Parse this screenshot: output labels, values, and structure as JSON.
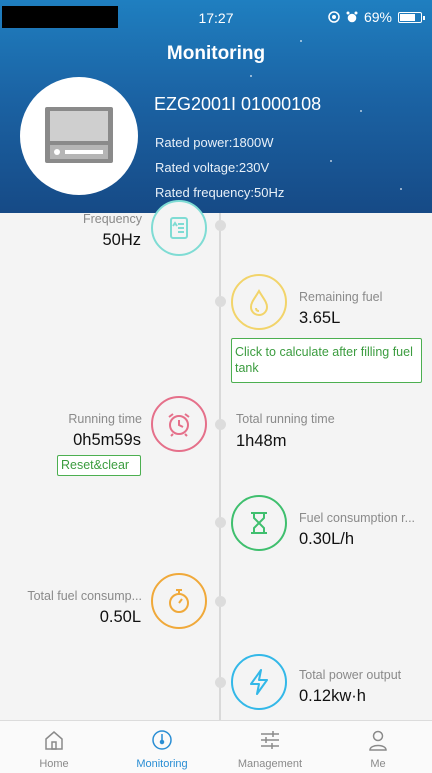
{
  "status_bar": {
    "time": "17:27",
    "battery": "69%"
  },
  "header": {
    "title": "Monitoring",
    "device_model": "EZG2001I 01000108",
    "rated_power": "Rated power:1800W",
    "rated_voltage": "Rated voltage:230V",
    "rated_frequency": "Rated frequency:50Hz"
  },
  "metrics": {
    "frequency": {
      "label": "Frequency",
      "value": "50Hz"
    },
    "remaining_fuel": {
      "label": "Remaining fuel",
      "value": "3.65L",
      "action": "Click to calculate after filling fuel tank"
    },
    "running_time": {
      "label": "Running time",
      "value": "0h5m59s",
      "action": "Reset&clear"
    },
    "total_running_time": {
      "label": "Total running time",
      "value": "1h48m"
    },
    "fuel_consumption_rate": {
      "label": "Fuel consumption r...",
      "value": "0.30L/h"
    },
    "total_fuel_consumption": {
      "label": "Total fuel consump...",
      "value": "0.50L"
    },
    "total_power_output": {
      "label": "Total power output",
      "value": "0.12kw·h"
    }
  },
  "colors": {
    "teal": "#7fdcd4",
    "yellow": "#f2d46a",
    "pink": "#e5708a",
    "green": "#3fbf6e",
    "orange": "#f0a93a",
    "blue": "#33b8e8",
    "active_nav": "#2a8ed4"
  },
  "bottom_nav": [
    {
      "label": "Home",
      "icon": "home-icon",
      "active": false
    },
    {
      "label": "Monitoring",
      "icon": "gauge-icon",
      "active": true
    },
    {
      "label": "Management",
      "icon": "sliders-icon",
      "active": false
    },
    {
      "label": "Me",
      "icon": "user-icon",
      "active": false
    }
  ]
}
